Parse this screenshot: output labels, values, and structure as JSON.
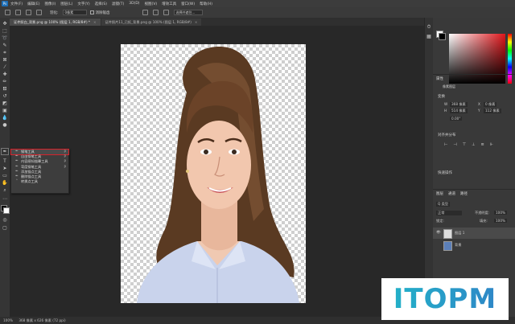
{
  "app": {
    "logo": "Ps",
    "menus": [
      "文件(F)",
      "编辑(E)",
      "图像(I)",
      "图层(L)",
      "文字(Y)",
      "选择(S)",
      "滤镜(T)",
      "3D(D)",
      "视图(V)",
      "增效工具",
      "窗口(W)",
      "帮助(H)"
    ]
  },
  "options": {
    "feather_label": "羽化:",
    "feather_value": "0像素",
    "antialias_label": "消除锯齿",
    "field_label": "选择并遮住..."
  },
  "tabs": [
    {
      "label": "证件照白_背景.png @ 100% (图层 1, RGB/8#) *",
      "close": "×"
    },
    {
      "label": "证件照片11_已抠_背景.png @ 100% (图层 1, RGB/8#)",
      "close": "×"
    }
  ],
  "flyout": {
    "items": [
      {
        "label": "钢笔工具",
        "key": "P"
      },
      {
        "label": "自由钢笔工具",
        "key": "P"
      },
      {
        "label": "内容感知描摹工具",
        "key": "P"
      },
      {
        "label": "弯度钢笔工具",
        "key": "P"
      },
      {
        "label": "添加锚点工具",
        "key": ""
      },
      {
        "label": "删除锚点工具",
        "key": ""
      },
      {
        "label": "转换点工具",
        "key": ""
      }
    ]
  },
  "panels": {
    "color_tabs": "颜色",
    "properties_title": "属性",
    "properties_tab": "像素图层",
    "transform_title": "变换",
    "w_label": "W",
    "w_value": "368 像素",
    "h_label": "H",
    "h_value": "514 像素",
    "x_label": "X",
    "x_value": "0 像素",
    "y_label": "Y",
    "y_value": "112 像素",
    "angle_value": "0.00°",
    "align_title": "对齐并分布",
    "quick_title": "快速操作",
    "layers_tabs": [
      "图层",
      "通道",
      "路径"
    ],
    "layers_kind": "Q 类型",
    "layers_mode": "正常",
    "opacity_label": "不透明度:",
    "opacity_value": "100%",
    "lock_label": "锁定:",
    "fill_label": "填充:",
    "fill_value": "100%",
    "layers": [
      {
        "name": "图层 1"
      },
      {
        "name": "背景"
      }
    ]
  },
  "status": {
    "zoom": "100%",
    "doc_info": "368 像素 x 626 像素 (72 ppi)"
  },
  "watermark": "ITOPM"
}
